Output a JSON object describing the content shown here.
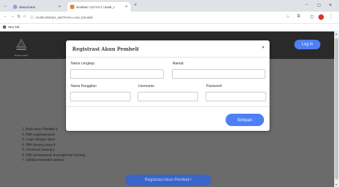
{
  "browser": {
    "tabs": [
      {
        "label": "Manual Mart",
        "active": false
      },
      {
        "label": "localhost / 127.0.0.1 / aresk_c",
        "active": true
      }
    ],
    "url": "localhost/dinpsi_rijal/?menu=cara_transaksi",
    "bookmarks": [
      {
        "label": "New Tab"
      }
    ]
  },
  "header": {
    "logo_text": "MANUAL MART",
    "login_label": "Log In",
    "accent_color": "#4d7ff5"
  },
  "steps": [
    "1. Buat akun Pembeli d",
    "2. Pilih registrasi pem",
    "3. Login dengan akun",
    "4. Pilih barang yang d",
    "5. Checkout barang y",
    "6. Pilih pembayaran & pengiriman barang",
    "7. Validasi transaksi selesai"
  ],
  "cta_label": "Registrasi Akun Pembeli !",
  "modal": {
    "title": "Registrasi Akun Pembeli",
    "close_label": "×",
    "fields": {
      "nama_lengkap": {
        "label": "Nama Lengkap:",
        "value": ""
      },
      "alamat": {
        "label": "Alamat:",
        "value": ""
      },
      "nama_panggilan": {
        "label": "Nama Panggilan:",
        "value": ""
      },
      "username": {
        "label": "Username:",
        "value": ""
      },
      "password": {
        "label": "Password:",
        "value": ""
      }
    },
    "save_label": "Simpan"
  }
}
